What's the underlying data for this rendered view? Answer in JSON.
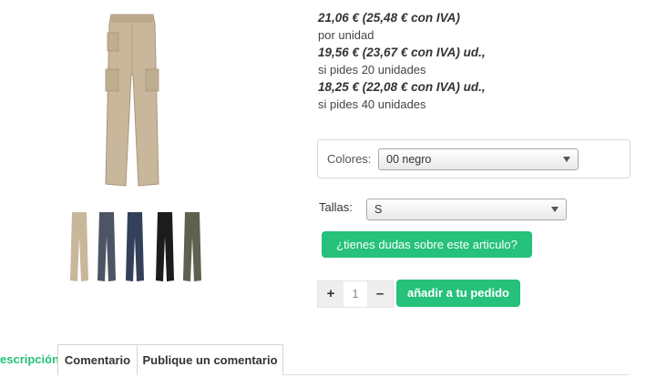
{
  "product": {
    "main_image_alt": "pantalón cargo beige",
    "thumbnails": [
      {
        "name": "beige",
        "color": "#c9b79b"
      },
      {
        "name": "gris",
        "color": "#4c5563"
      },
      {
        "name": "azul marino",
        "color": "#34405a"
      },
      {
        "name": "negro",
        "color": "#1c1c1e"
      },
      {
        "name": "verde",
        "color": "#5c6150"
      }
    ]
  },
  "prices": {
    "unit_price": "21,06 € (25,48 € con IVA)",
    "unit_note": "por unidad",
    "tier1_price": "19,56 € (23,67 € con IVA) ud.,",
    "tier1_note": "si pides 20 unidades",
    "tier2_price": "18,25 € (22,08 € con IVA) ud.,",
    "tier2_note": "si pides 40 unidades"
  },
  "options": {
    "colors_label": "Colores:",
    "colors_value": "00 negro",
    "sizes_label": "Tallas:",
    "sizes_value": "S"
  },
  "actions": {
    "question_button": "¿tienes dudas sobre este articulo?",
    "qty_plus": "+",
    "qty_value": "1",
    "qty_minus": "–",
    "add_button": "añadir a tu pedido"
  },
  "tabs": [
    {
      "label": "escripción",
      "active": true
    },
    {
      "label": "Comentario",
      "active": false
    },
    {
      "label": "Publique un comentario",
      "active": false
    }
  ],
  "colors": {
    "accent_green": "#26c17a",
    "pants_beige": "#c9b79b"
  }
}
